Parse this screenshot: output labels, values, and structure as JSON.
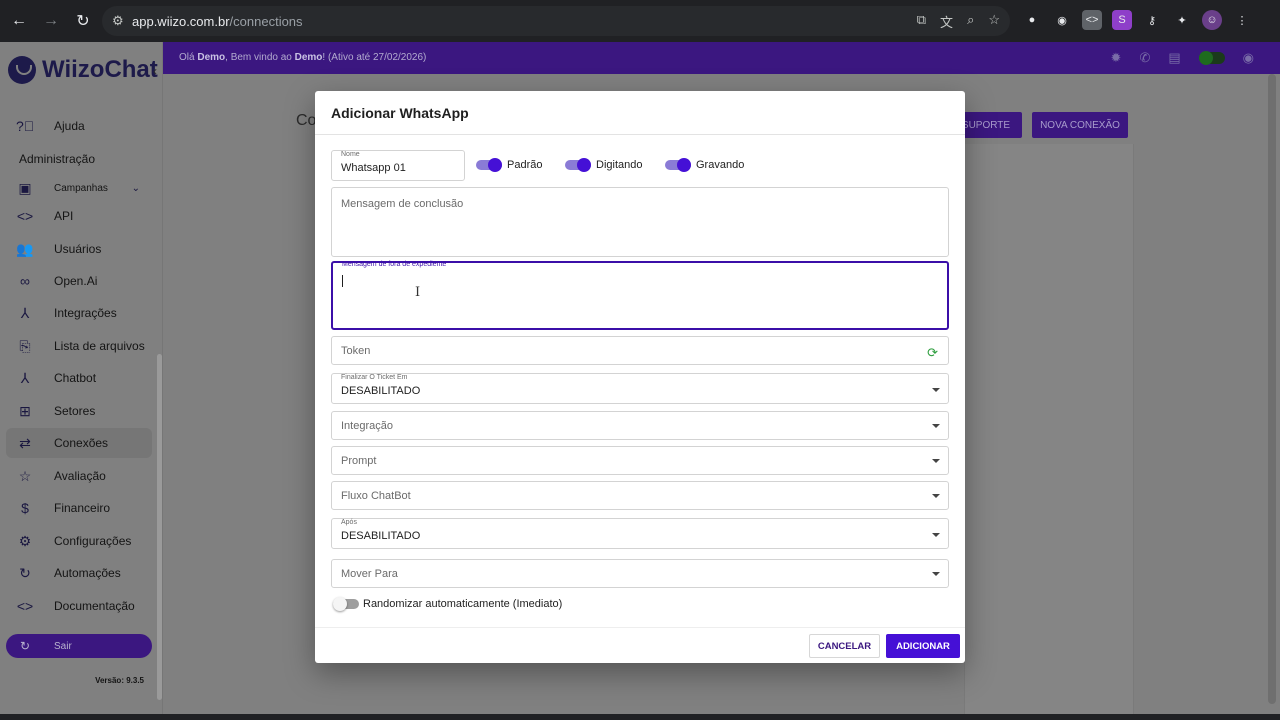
{
  "browser": {
    "url_host": "app.wiizo.com.br",
    "url_path": "/connections"
  },
  "sidebar": {
    "logo_text": "WiizoChat",
    "items": [
      {
        "label": "Ajuda",
        "icon": "help-icon"
      },
      {
        "label": "Campanhas",
        "icon": "campaign-icon"
      },
      {
        "label": "API",
        "icon": "code-icon"
      },
      {
        "label": "Usuários",
        "icon": "users-icon"
      },
      {
        "label": "Open.Ai",
        "icon": "infinity-icon"
      },
      {
        "label": "Integrações",
        "icon": "integration-icon"
      },
      {
        "label": "Lista de arquivos",
        "icon": "paperclip-icon"
      },
      {
        "label": "Chatbot",
        "icon": "chatbot-icon"
      },
      {
        "label": "Setores",
        "icon": "sectors-icon"
      },
      {
        "label": "Conexões",
        "icon": "swap-icon"
      },
      {
        "label": "Avaliação",
        "icon": "star-icon"
      },
      {
        "label": "Financeiro",
        "icon": "money-icon"
      },
      {
        "label": "Configurações",
        "icon": "gear-icon"
      },
      {
        "label": "Automações",
        "icon": "refresh-icon"
      },
      {
        "label": "Documentação",
        "icon": "code-icon"
      }
    ],
    "section_title": "Administração",
    "logout_label": "Sair",
    "version": "Versão: 9.3.5"
  },
  "topbar": {
    "greeting_prefix": "Olá ",
    "user": "Demo",
    "greeting_mid": ", Bem vindo ao ",
    "company": "Demo",
    "greeting_suffix": "! (Ativo até 27/02/2026)"
  },
  "page": {
    "title_partial": "Co",
    "support_button": "SUPORTE",
    "new_connection_button": "NOVA CONEXÃO"
  },
  "modal": {
    "title": "Adicionar WhatsApp",
    "name_label": "Nome",
    "name_value": "Whatsapp 01",
    "toggles": [
      {
        "label": "Padrão",
        "on": true
      },
      {
        "label": "Digitando",
        "on": true
      },
      {
        "label": "Gravando",
        "on": true
      }
    ],
    "completion_placeholder": "Mensagem de conclusão",
    "out_of_hours_label": "Mensagem de fora de expediente",
    "token_placeholder": "Token",
    "finalize_label": "Finalizar O Ticket Em",
    "finalize_value": "DESABILITADO",
    "integration_placeholder": "Integração",
    "prompt_placeholder": "Prompt",
    "flow_placeholder": "Fluxo ChatBot",
    "after_label": "Após",
    "after_value": "DESABILITADO",
    "move_placeholder": "Mover Para",
    "randomize_label": "Randomizar automaticamente (Imediato)",
    "cancel_label": "CANCELAR",
    "add_label": "ADICIONAR"
  }
}
